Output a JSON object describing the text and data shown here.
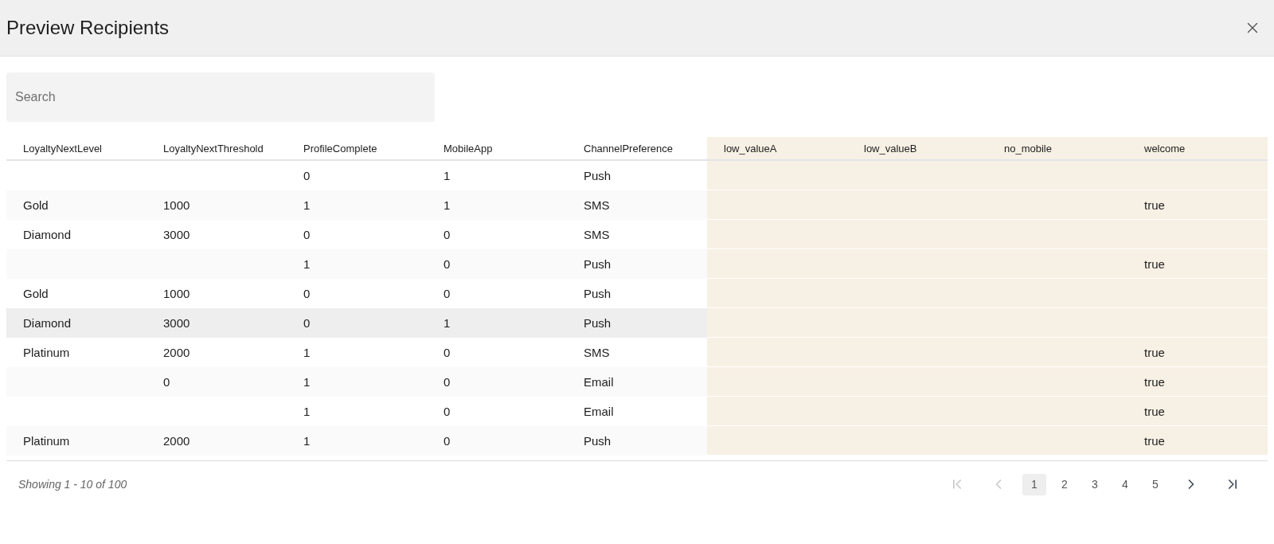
{
  "dialog": {
    "title": "Preview Recipients"
  },
  "search": {
    "placeholder": "Search"
  },
  "table": {
    "columns": [
      {
        "label": "LoyaltyNextLevel",
        "highlighted": false
      },
      {
        "label": "LoyaltyNextThreshold",
        "highlighted": false
      },
      {
        "label": "ProfileComplete",
        "highlighted": false
      },
      {
        "label": "MobileApp",
        "highlighted": false
      },
      {
        "label": "ChannelPreference",
        "highlighted": false
      },
      {
        "label": "low_valueA",
        "highlighted": true
      },
      {
        "label": "low_valueB",
        "highlighted": true
      },
      {
        "label": "no_mobile",
        "highlighted": true
      },
      {
        "label": "welcome",
        "highlighted": true
      }
    ],
    "rows": [
      {
        "selected": false,
        "cells": [
          null,
          null,
          "0",
          "1",
          "Push",
          null,
          null,
          null,
          null
        ]
      },
      {
        "selected": false,
        "cells": [
          "Gold",
          "1000",
          "1",
          "1",
          "SMS",
          null,
          null,
          null,
          "true"
        ]
      },
      {
        "selected": false,
        "cells": [
          "Diamond",
          "3000",
          "0",
          "0",
          "SMS",
          null,
          null,
          null,
          null
        ]
      },
      {
        "selected": false,
        "cells": [
          null,
          null,
          "1",
          "0",
          "Push",
          null,
          null,
          null,
          "true"
        ]
      },
      {
        "selected": false,
        "cells": [
          "Gold",
          "1000",
          "0",
          "0",
          "Push",
          null,
          null,
          null,
          null
        ]
      },
      {
        "selected": true,
        "cells": [
          "Diamond",
          "3000",
          "0",
          "1",
          "Push",
          null,
          null,
          null,
          null
        ]
      },
      {
        "selected": false,
        "cells": [
          "Platinum",
          "2000",
          "1",
          "0",
          "SMS",
          null,
          null,
          null,
          "true"
        ]
      },
      {
        "selected": false,
        "cells": [
          null,
          "0",
          "1",
          "0",
          "Email",
          null,
          null,
          null,
          "true"
        ]
      },
      {
        "selected": false,
        "cells": [
          null,
          null,
          "1",
          "0",
          "Email",
          null,
          null,
          null,
          "true"
        ]
      },
      {
        "selected": false,
        "cells": [
          "Platinum",
          "2000",
          "1",
          "0",
          "Push",
          null,
          null,
          null,
          "true"
        ]
      }
    ]
  },
  "footer": {
    "summary": "Showing 1 - 10 of 100",
    "pager": [
      {
        "kind": "first",
        "disabled": true
      },
      {
        "kind": "prev",
        "disabled": true
      },
      {
        "kind": "page",
        "label": "1",
        "selected": true
      },
      {
        "kind": "page",
        "label": "2",
        "selected": false
      },
      {
        "kind": "page",
        "label": "3",
        "selected": false
      },
      {
        "kind": "page",
        "label": "4",
        "selected": false
      },
      {
        "kind": "page",
        "label": "5",
        "selected": false
      },
      {
        "kind": "next",
        "disabled": false
      },
      {
        "kind": "last",
        "disabled": false
      }
    ]
  }
}
